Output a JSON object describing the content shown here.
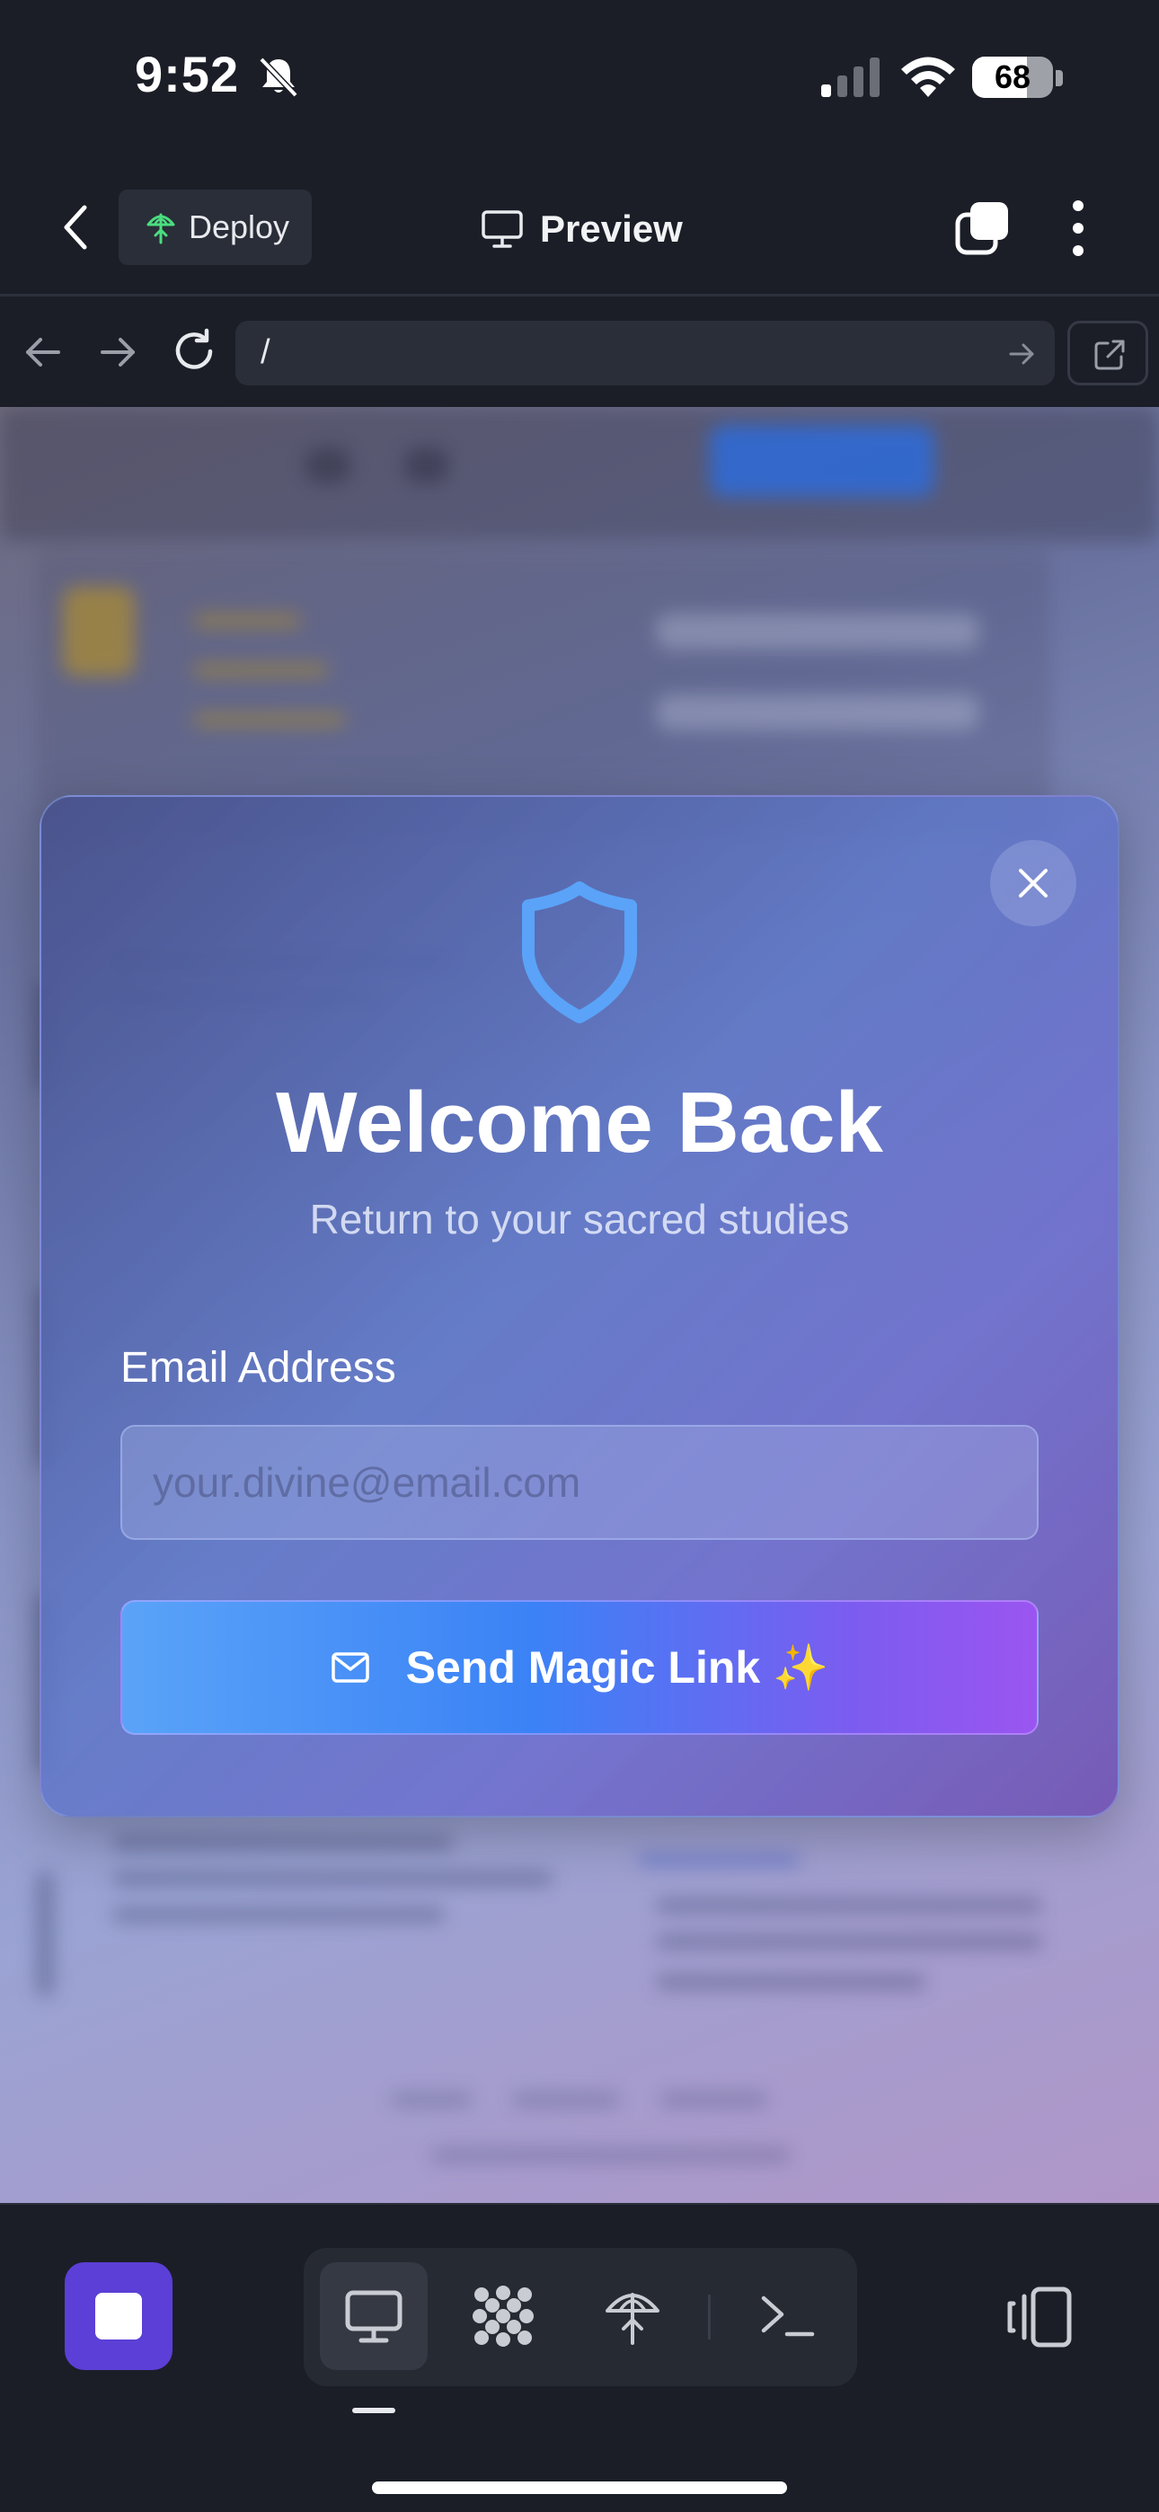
{
  "status_bar": {
    "time": "9:52",
    "battery": "68",
    "battery_level": 0.68
  },
  "header": {
    "deploy_label": "Deploy",
    "title": "Preview"
  },
  "browser": {
    "url": "/"
  },
  "modal": {
    "title": "Welcome Back",
    "subtitle": "Return to your sacred studies",
    "email_label": "Email Address",
    "email_placeholder": "your.divine@email.com",
    "email_value": "",
    "submit_label": "Send Magic Link ✨"
  },
  "colors": {
    "accent": "#3b82f6",
    "accent_purple": "#9b55f0",
    "stop_button": "#5b3fd6",
    "deploy_icon": "#4ade80",
    "shield": "#5aa3f8"
  },
  "toolbar": {
    "stop_icon": "stop-icon",
    "tools": [
      "monitor-icon",
      "dots-grid-icon",
      "deploy-icon",
      "terminal-icon"
    ],
    "active_tool": "monitor-icon",
    "devices_icon": "devices-icon"
  }
}
